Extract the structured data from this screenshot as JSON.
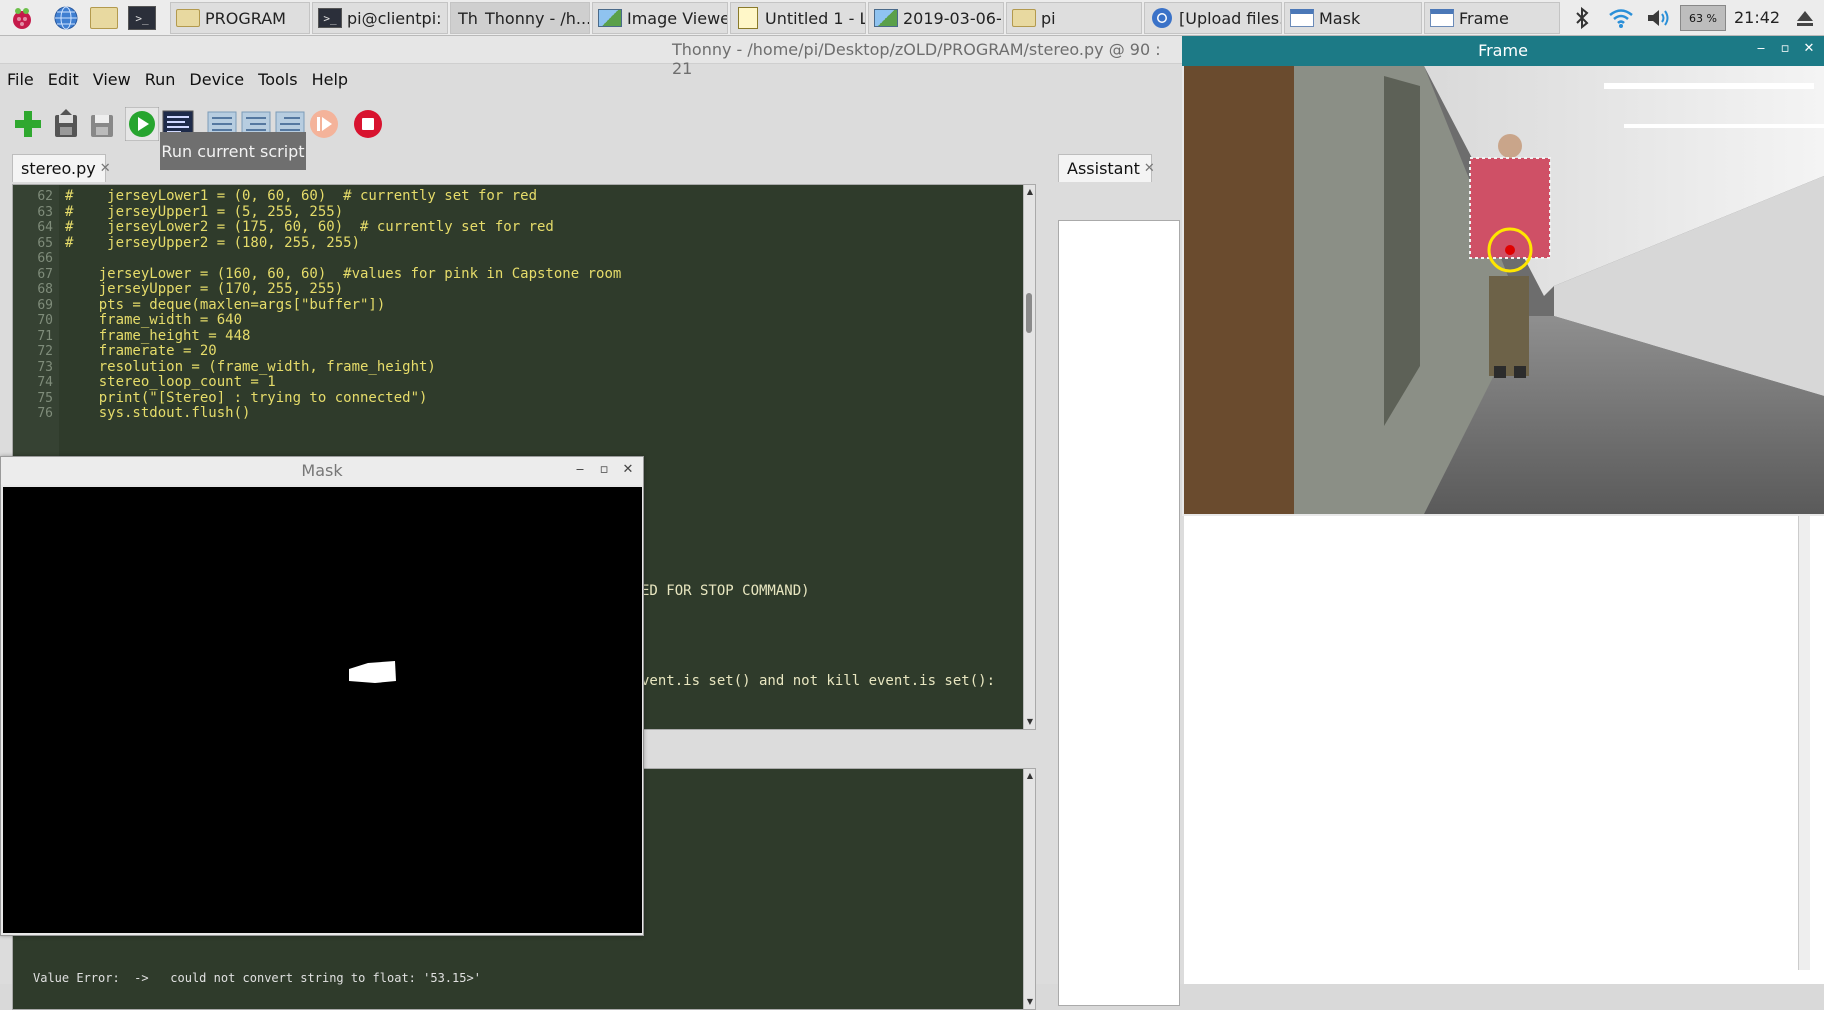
{
  "taskbar": {
    "launchers": [
      "raspberry-menu",
      "web-browser",
      "file-manager",
      "terminal"
    ],
    "tasks": [
      {
        "label": "PROGRAM",
        "icon": "folder-icon"
      },
      {
        "label": "pi@clientpi: ...",
        "icon": "terminal-icon"
      },
      {
        "label": "Thonny  -  /h...",
        "icon": "thonny-icon"
      },
      {
        "label": "Image Viewer",
        "icon": "image-icon"
      },
      {
        "label": "Untitled 1 - L...",
        "icon": "document-icon"
      },
      {
        "label": "2019-03-06-...",
        "icon": "image-icon"
      },
      {
        "label": "pi",
        "icon": "folder-icon"
      },
      {
        "label": "[Upload files...",
        "icon": "chromium-icon"
      },
      {
        "label": "Mask",
        "icon": "window-icon"
      },
      {
        "label": "Frame",
        "icon": "window-icon"
      }
    ],
    "cpu_label": "63 %",
    "clock": "21:42"
  },
  "thonny": {
    "title": "Thonny  -  /home/pi/Desktop/zOLD/PROGRAM/stereo.py  @  90 : 21",
    "menu": [
      "File",
      "Edit",
      "View",
      "Run",
      "Device",
      "Tools",
      "Help"
    ],
    "tooltip": "Run current script",
    "editor_tab": "stereo.py",
    "assistant_tab": "Assistant",
    "close_glyph": "✕",
    "lines": [
      {
        "n": "62",
        "text": "#    jerseyLower1 = (0, 60, 60)  # currently set for red"
      },
      {
        "n": "63",
        "text": "#    jerseyUpper1 = (5, 255, 255)"
      },
      {
        "n": "64",
        "text": "#    jerseyLower2 = (175, 60, 60)  # currently set for red"
      },
      {
        "n": "65",
        "text": "#    jerseyUpper2 = (180, 255, 255)"
      },
      {
        "n": "66",
        "text": ""
      },
      {
        "n": "67",
        "text": "    jerseyLower = (160, 60, 60)  #values for pink in Capstone room"
      },
      {
        "n": "68",
        "text": "    jerseyUpper = (170, 255, 255)"
      },
      {
        "n": "69",
        "text": "    pts = deque(maxlen=args[\"buffer\"])"
      },
      {
        "n": "70",
        "text": "    frame_width = 640"
      },
      {
        "n": "71",
        "text": "    frame_height = 448"
      },
      {
        "n": "72",
        "text": "    framerate = 20"
      },
      {
        "n": "73",
        "text": "    resolution = (frame_width, frame_height)"
      },
      {
        "n": "74",
        "text": "    stereo_loop_count = 1"
      },
      {
        "n": "75",
        "text": "    print(\"[Stereo] : trying to connected\")"
      },
      {
        "n": "76",
        "text": "    sys.stdout.flush()"
      }
    ],
    "partial_line_1": "ED FOR STOP COMMAND)",
    "partial_line_2": "vent.is set() and not kill event.is set():",
    "shell_error": "Value Error:  ->   could not convert string to float: '53.15>'"
  },
  "mask_window": {
    "title": "Mask",
    "min": "‒",
    "max": "▫",
    "close": "✕"
  },
  "frame_window": {
    "title": "Frame",
    "min": "‒",
    "max": "▫",
    "close": "✕"
  }
}
